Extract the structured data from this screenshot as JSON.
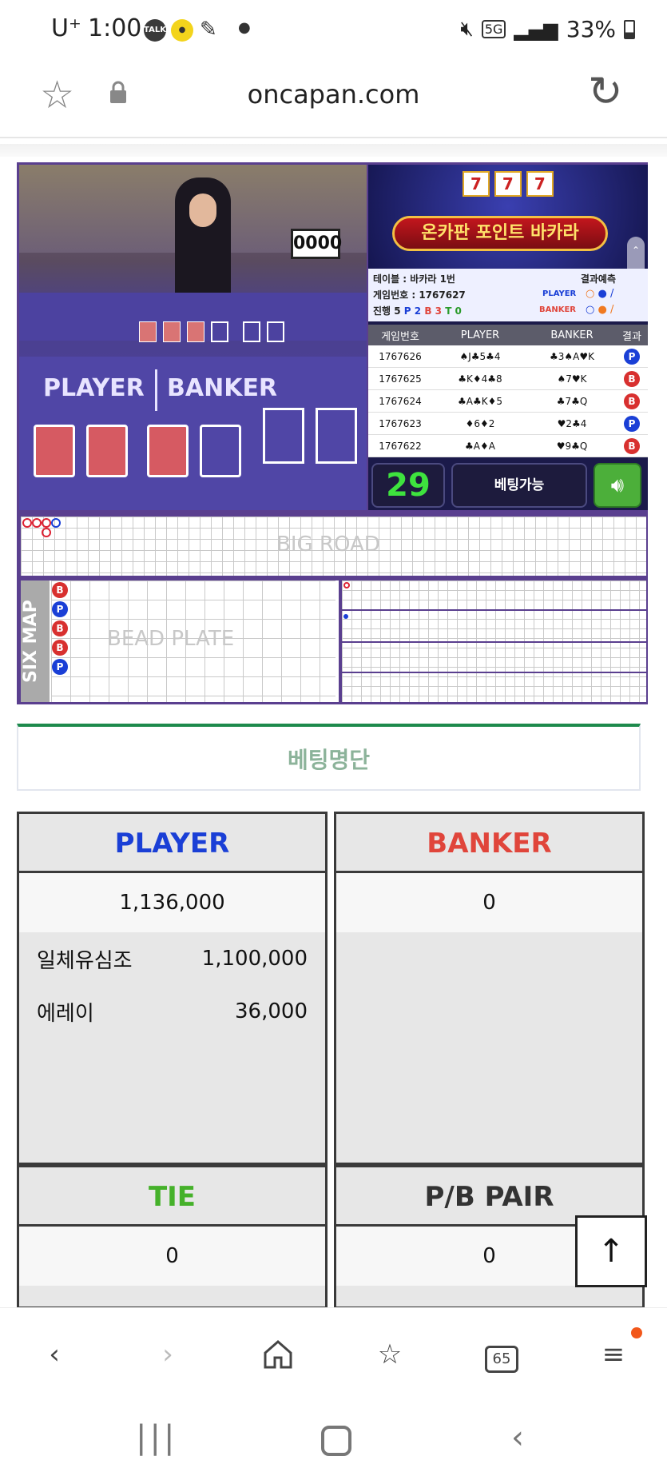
{
  "status_bar": {
    "carrier": "U⁺",
    "time": "1:00",
    "battery": "33%",
    "network": "5G"
  },
  "browser": {
    "url": "oncapan.com",
    "tab_count": "65"
  },
  "promo": {
    "title": "온카판 포인트 바카라",
    "slot_digits": [
      "7",
      "7",
      "7"
    ],
    "table_badge": "0000"
  },
  "game_info": {
    "table_label": "테이블 : 바카라 1번",
    "game_number_label": "게임번호 : 1767627",
    "progress_label": "진행 5",
    "progress_p": "P 2",
    "progress_b": "B 3",
    "progress_t": "T 0",
    "prediction_label": "결과예측",
    "player_label": "PLAYER",
    "banker_label": "BANKER"
  },
  "results": {
    "headers": [
      "게임번호",
      "PLAYER",
      "BANKER",
      "결과"
    ],
    "rows": [
      {
        "game": "1767626",
        "player": "♠J♣5♣4",
        "banker": "♣3♠A♥K",
        "result": "P"
      },
      {
        "game": "1767625",
        "player": "♣K♦4♣8",
        "banker": "♠7♥K",
        "result": "B"
      },
      {
        "game": "1767624",
        "player": "♣A♣K♦5",
        "banker": "♣7♣Q",
        "result": "B"
      },
      {
        "game": "1767623",
        "player": "♦6♦2",
        "banker": "♥2♣4",
        "result": "P"
      },
      {
        "game": "1767622",
        "player": "♣A♦A",
        "banker": "♥9♣Q",
        "result": "B"
      }
    ]
  },
  "controls": {
    "timer": "29",
    "betting_status": "베팅가능"
  },
  "roads": {
    "big_road_label": "BIG ROAD",
    "bead_plate_label": "BEAD PLATE",
    "six_map_label": "SIX MAP",
    "bead_results": [
      "B",
      "P",
      "B",
      "B",
      "P"
    ]
  },
  "video_labels": {
    "player": "PLAYER",
    "banker": "BANKER"
  },
  "betting_list": {
    "heading": "베팅명단",
    "player": {
      "title": "PLAYER",
      "total": "1,136,000",
      "entries": [
        {
          "name": "일체유심조",
          "amount": "1,100,000"
        },
        {
          "name": "에레이",
          "amount": "36,000"
        }
      ]
    },
    "banker": {
      "title": "BANKER",
      "total": "0"
    },
    "tie": {
      "title": "TIE",
      "total": "0"
    },
    "pair": {
      "title": "P/B PAIR",
      "total": "0"
    }
  },
  "colors": {
    "player_blue": "#1a3fd6",
    "banker_red": "#e0453b",
    "tie_green": "#45b12a",
    "accent_green": "#1d8a4c",
    "board_purple": "#5a3f8f"
  }
}
